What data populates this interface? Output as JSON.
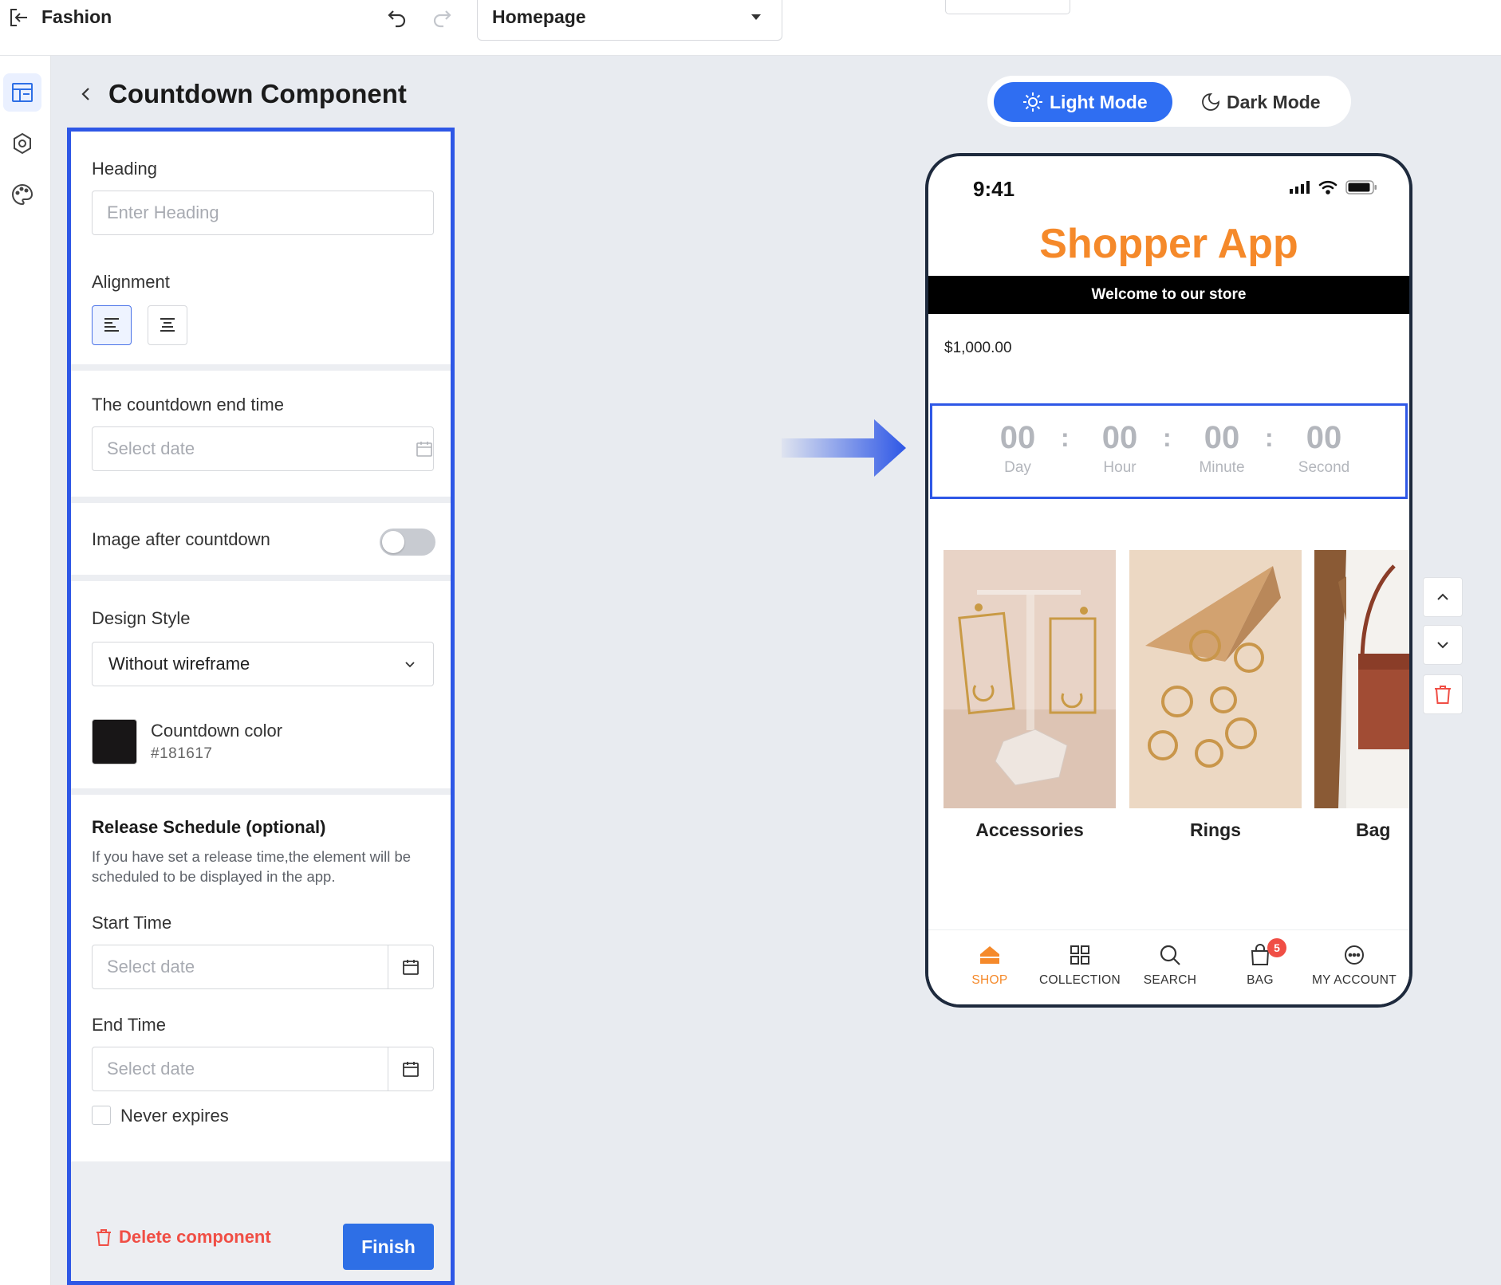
{
  "topbar": {
    "app_name": "Fashion",
    "page_select": {
      "value": "Homepage"
    }
  },
  "rail": {
    "items": [
      {
        "icon": "layout-icon",
        "active": true
      },
      {
        "icon": "settings-hex-icon",
        "active": false
      },
      {
        "icon": "palette-icon",
        "active": false
      }
    ]
  },
  "panel": {
    "title": "Countdown Component",
    "heading": {
      "label": "Heading",
      "placeholder": "Enter Heading",
      "value": ""
    },
    "alignment": {
      "label": "Alignment",
      "options": [
        "left",
        "center"
      ],
      "selected": "left"
    },
    "countdown_end": {
      "label": "The countdown end time",
      "placeholder": "Select date"
    },
    "image_after": {
      "label": "Image after countdown",
      "enabled": false
    },
    "design_style": {
      "label": "Design Style",
      "value": "Without wireframe"
    },
    "countdown_color": {
      "label": "Countdown color",
      "hex": "#181617"
    },
    "release": {
      "title": "Release Schedule (optional)",
      "description": "If you have set a release time,the element will be scheduled to be displayed in the app.",
      "start_label": "Start Time",
      "start_placeholder": "Select date",
      "end_label": "End Time",
      "end_placeholder": "Select date",
      "never_expires": "Never expires"
    },
    "footer": {
      "delete_label": "Delete component",
      "finish_label": "Finish"
    }
  },
  "mode": {
    "light": "Light Mode",
    "dark": "Dark Mode",
    "selected": "light"
  },
  "phone": {
    "time": "9:41",
    "app_title": "Shopper App",
    "banner": "Welcome to our store",
    "price": "$1,000.00",
    "countdown": [
      {
        "value": "00",
        "label": "Day"
      },
      {
        "value": "00",
        "label": "Hour"
      },
      {
        "value": "00",
        "label": "Minute"
      },
      {
        "value": "00",
        "label": "Second"
      }
    ],
    "countdown_separator": ":",
    "tiles": [
      {
        "label": "Accessories"
      },
      {
        "label": "Rings"
      },
      {
        "label": "Bag"
      }
    ],
    "tabs": [
      {
        "label": "SHOP",
        "icon": "shop-icon",
        "active": true
      },
      {
        "label": "COLLECTION",
        "icon": "grid-icon",
        "active": false
      },
      {
        "label": "SEARCH",
        "icon": "search-icon",
        "active": false
      },
      {
        "label": "BAG",
        "icon": "bag-icon",
        "active": false,
        "badge": "5"
      },
      {
        "label": "MY ACCOUNT",
        "icon": "account-icon",
        "active": false
      }
    ]
  },
  "colors": {
    "accent": "#2e6fe6",
    "highlight_border": "#2e57e6",
    "brand_orange": "#f5892a",
    "danger": "#f04e45"
  }
}
